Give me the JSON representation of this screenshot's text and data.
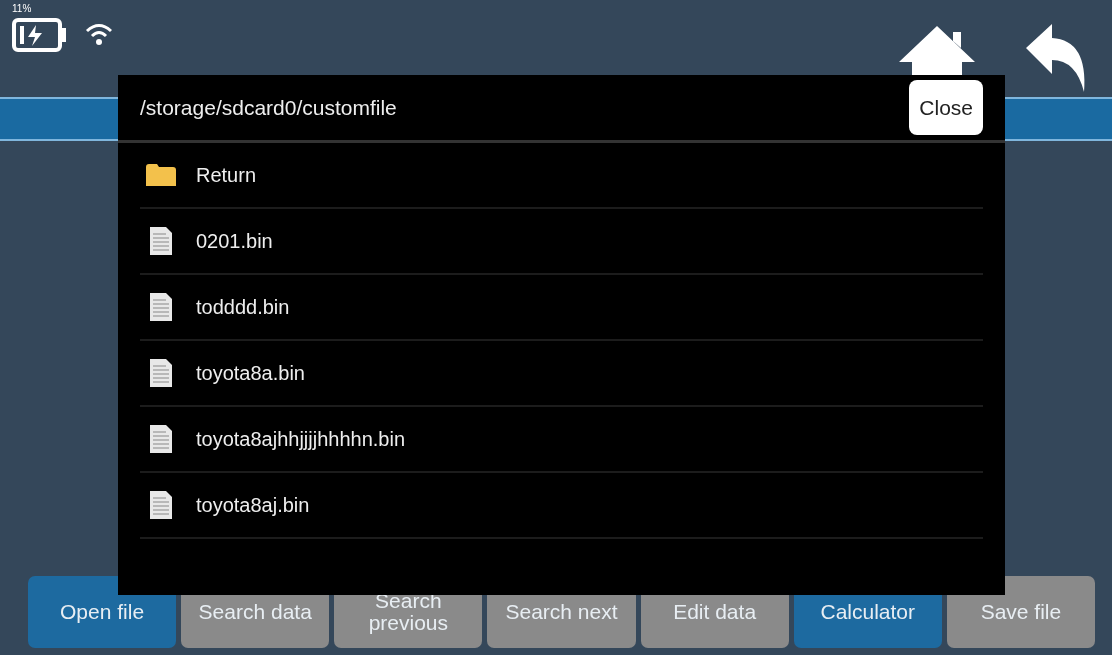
{
  "status_bar": {
    "battery_percent": "11%"
  },
  "dialog": {
    "path": "/storage/sdcard0/customfile",
    "close_button": "Close",
    "items": [
      {
        "kind": "folder",
        "label": "Return"
      },
      {
        "kind": "file",
        "label": "0201.bin"
      },
      {
        "kind": "file",
        "label": "todddd.bin"
      },
      {
        "kind": "file",
        "label": "toyota8a.bin"
      },
      {
        "kind": "file",
        "label": "toyota8ajhhjjjjhhhhn.bin"
      },
      {
        "kind": "file",
        "label": "toyota8aj.bin"
      }
    ]
  },
  "toolbar": [
    {
      "label": "Open file",
      "color": "#1d6aa0"
    },
    {
      "label": "Search data",
      "color": "#8a8a8a"
    },
    {
      "label": "Search previous",
      "color": "#8a8a8a"
    },
    {
      "label": "Search next",
      "color": "#8a8a8a"
    },
    {
      "label": "Edit data",
      "color": "#8a8a8a"
    },
    {
      "label": "Calculator",
      "color": "#1d6aa0"
    },
    {
      "label": "Save file",
      "color": "#8a8a8a"
    }
  ]
}
